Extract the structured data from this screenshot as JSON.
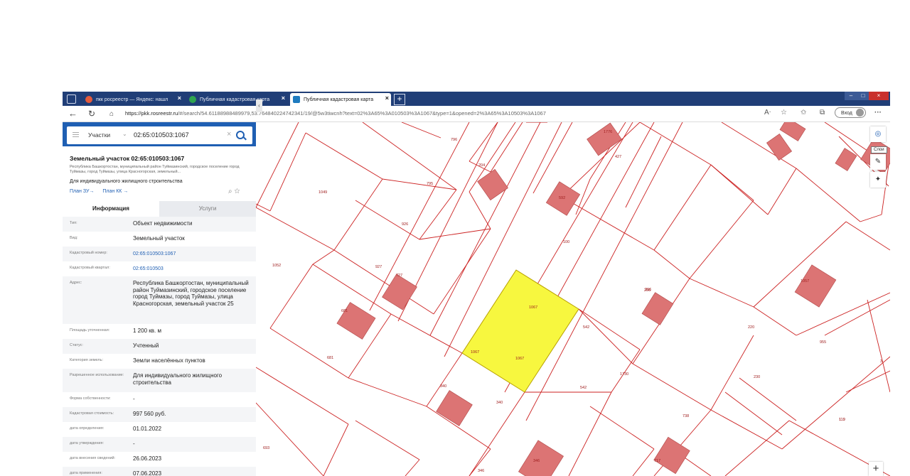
{
  "browser": {
    "tabs": [
      {
        "title": "пкк росреестр — Яндекс: нашл",
        "icon": "yandex-icon",
        "color": "#e55b3c"
      },
      {
        "title": "Публичная кадастровая карта",
        "icon": "checkmark-shield-icon",
        "color": "#2ea44f"
      },
      {
        "title": "Публичная кадастровая карта",
        "icon": "map-favicon",
        "color": "#1e7bbf"
      }
    ],
    "new_tab": "+",
    "url_host": "https://pkk.rosreestr.ru",
    "url_path": "/#/search/54.61188988489979,53.764840224742341/19/@5w3tiwcnh?text=02%3A65%3A010503%3A1067&type=1&opened=2%3A65%3A10503%3A1067",
    "login_label": "Вход"
  },
  "search": {
    "category": "Участки",
    "query": "02:65:010503:1067",
    "clear_icon": "×"
  },
  "parcel": {
    "title": "Земельный участок 02:65:010503:1067",
    "address_short": "Республика Башкортостан, муниципальный район Туймазинский, городское поселение город Туймазы, город Туймазы, улица Красногорская, земельный...",
    "use": "Для индивидуального жилищного строительства",
    "plan_zu": "План ЗУ→",
    "plan_kk": "План КК →"
  },
  "info_tabs": {
    "info": "Информация",
    "services": "Услуги"
  },
  "rows": [
    {
      "key": "Тип:",
      "value": "Объект недвижимости",
      "h": 21
    },
    {
      "key": "Вид:",
      "value": "Земельный участок",
      "h": 21
    },
    {
      "key": "Кадастровый номер:",
      "value": "02:65:010503:1067",
      "link": true,
      "h": 21
    },
    {
      "key": "Кадастровый квартал:",
      "value": "02:65:010503",
      "link": true,
      "h": 21
    },
    {
      "key": "Адрес:",
      "value": "Республика Башкортостан, муниципальный район Туймазинский, городское поселение город Туймазы, город Туймазы, улица Красногорская, земельный участок 25",
      "h": 67
    },
    {
      "key": "Площадь уточненная:",
      "value": "1 200 кв. м",
      "h": 21
    },
    {
      "key": "Статус:",
      "value": "Учтенный",
      "h": 21
    },
    {
      "key": "Категория земель:",
      "value": "Земли населённых пунктов",
      "h": 21
    },
    {
      "key": "Разрешенное использование:",
      "value": "Для индивидуального жилищного строительства",
      "h": 33
    },
    {
      "key": "Форма собственности:",
      "value": "-",
      "h": 21
    },
    {
      "key": "Кадастровая стоимость:",
      "value": "997 560 руб.",
      "h": 21
    },
    {
      "key": "дата определения:",
      "value": "01.01.2022",
      "h": 21
    },
    {
      "key": "дата утверждения:",
      "value": "-",
      "h": 21
    },
    {
      "key": "дата внесения сведений:",
      "value": "26.06.2023",
      "h": 21
    },
    {
      "key": "дата применения:",
      "value": "07.06.2023",
      "h": 21
    }
  ],
  "map": {
    "parcel_fill": "#f7f73f",
    "building_fill": "#dc7474",
    "line_color": "#cc2222",
    "labels": [
      "796",
      "427",
      "1049",
      "795",
      "926",
      "1052",
      "927",
      "100",
      "681",
      "1067",
      "542",
      "206",
      "220",
      "955",
      "681",
      "1067",
      "1067",
      "542",
      "206",
      "230",
      "119",
      "340",
      "340",
      "346",
      "346",
      "717",
      "738",
      "693",
      "3",
      "1776",
      "204",
      "592",
      "727",
      "1730",
      "1057",
      "119"
    ],
    "layers_tooltip": "Слои",
    "zoom_in": "+"
  }
}
